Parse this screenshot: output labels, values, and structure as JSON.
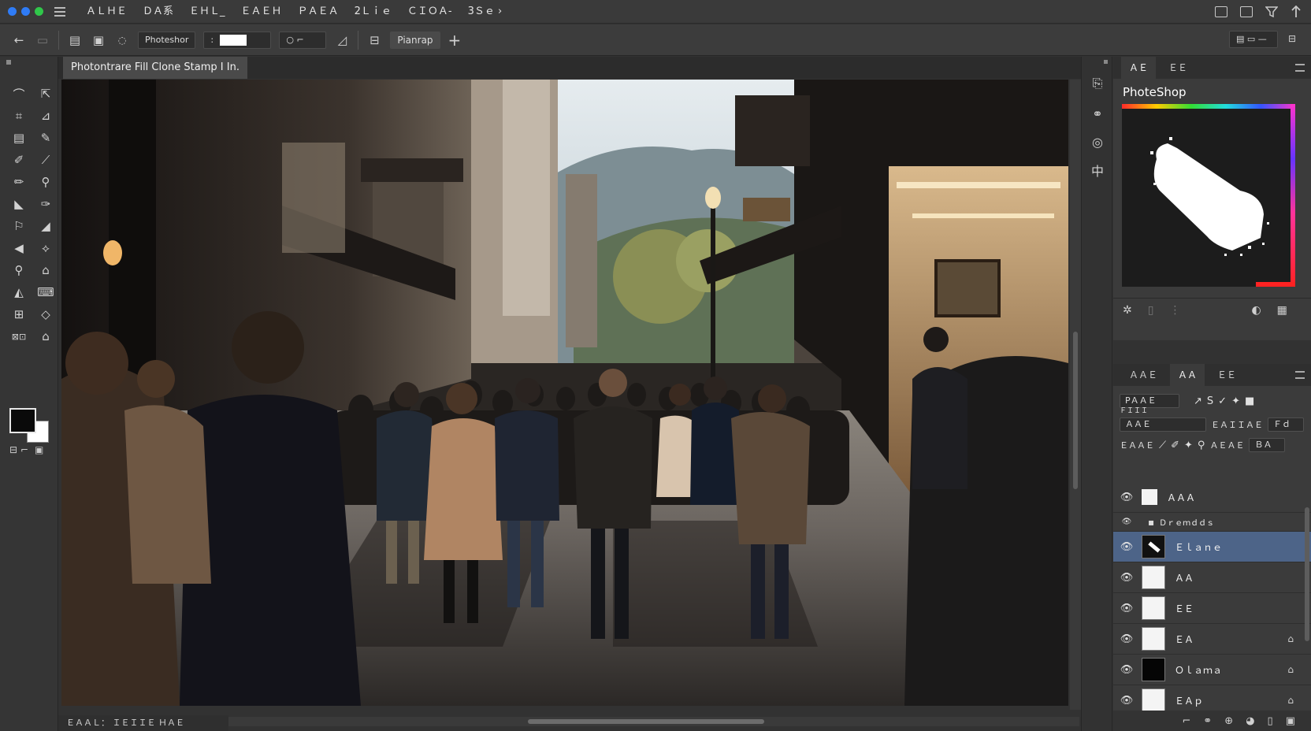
{
  "menubar": {
    "traffic": [
      "#2f7cf6",
      "#2f7cf6",
      "#30c74a"
    ],
    "items": [
      "ＡＬＨＥ",
      "ＤＡ系",
      "ＥＨＬ_",
      "ＥＡＥＨ",
      "ＰＡＥＡ",
      "2Ｌｉｅ",
      "ＣＩＯＡ-",
      "3Ｓｅ ›"
    ]
  },
  "options": {
    "preset": "Photeshor",
    "mode": "Pianrap",
    "plus": "+"
  },
  "document": {
    "tab_title": "Photontrare Fill Clone Stamp I In.",
    "status": "ＥＡＡＬ： ＩＥＩＩＥ ＨＡＥ"
  },
  "color_panel": {
    "tabs": [
      "ＡＥ",
      "ＥＥ"
    ],
    "title": "PhoteShop"
  },
  "layers_panel": {
    "tabs": [
      "ＡＡＥ",
      "ＡＡ",
      "ＥＥ"
    ],
    "blend_mode": "PＡＡＥ",
    "blend_sub": "ＦＩＩＩ",
    "opacity_label": "ＡＡＥ",
    "opacity_text": "ＥＡＩＩＡＥ",
    "opacity_value": "Ｆｄ",
    "fill_label": "ＥＡＡＥ",
    "fill_text": "ＡＥＡＥ",
    "fill_value": "ＢＡ",
    "layers": [
      {
        "name": "ＡＡＡ",
        "thumb": "white",
        "lock": false
      },
      {
        "name": "Ｄｒｅｍｄｄｓ",
        "thumb": "group",
        "lock": false
      },
      {
        "name": "Ｅｌａｎｅ",
        "thumb": "mask",
        "lock": false,
        "selected": true
      },
      {
        "name": "ＡＡ",
        "thumb": "white",
        "lock": false
      },
      {
        "name": "ＥＥ",
        "thumb": "white",
        "lock": false
      },
      {
        "name": "ＥＡ",
        "thumb": "white",
        "lock": true
      },
      {
        "name": "Ｏｌａｍａ",
        "thumb": "black",
        "lock": true
      },
      {
        "name": "ＥＡｐ",
        "thumb": "white",
        "lock": true
      }
    ]
  },
  "icons": {
    "back": "back-arrow-icon",
    "brush": "brush-icon",
    "eye": "eye-icon",
    "lock": "lock-icon"
  }
}
